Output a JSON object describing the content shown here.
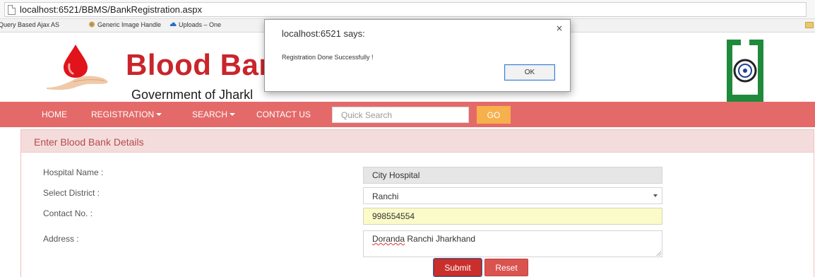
{
  "browser": {
    "url": "localhost:6521/BBMS/BankRegistration.aspx",
    "bookmarks": [
      {
        "label": "Query Based Ajax AS",
        "icon": "none"
      },
      {
        "label": "Generic Image Handle",
        "icon": "handler-icon"
      },
      {
        "label": "Uploads – One",
        "icon": "cloud-icon"
      }
    ]
  },
  "header": {
    "title": "Blood Bar",
    "subtitle": "Government of Jharkl",
    "colors": {
      "title": "#c9252b",
      "nav": "#e46a6a",
      "go": "#f6b04c"
    }
  },
  "nav": {
    "items": [
      {
        "label": "HOME",
        "dropdown": false
      },
      {
        "label": "REGISTRATION",
        "dropdown": true
      },
      {
        "label": "SEARCH",
        "dropdown": true
      },
      {
        "label": "CONTACT US",
        "dropdown": false
      }
    ],
    "search_placeholder": "Quick Search",
    "go_label": "GO"
  },
  "form": {
    "heading": "Enter Blood Bank Details",
    "fields": [
      {
        "label": "Hospital Name :",
        "value": "City Hospital"
      },
      {
        "label": "Select District :",
        "value": "Ranchi"
      },
      {
        "label": "Contact No. :",
        "value": "998554554"
      },
      {
        "label": "Address :",
        "value_spell": "Doranda",
        "value_rest": " Ranchi Jharkhand"
      }
    ],
    "submit_label": "Submit",
    "reset_label": "Reset"
  },
  "dialog": {
    "title": "localhost:6521 says:",
    "message": "Registration Done Successfully !",
    "ok_label": "OK",
    "close_glyph": "×"
  }
}
